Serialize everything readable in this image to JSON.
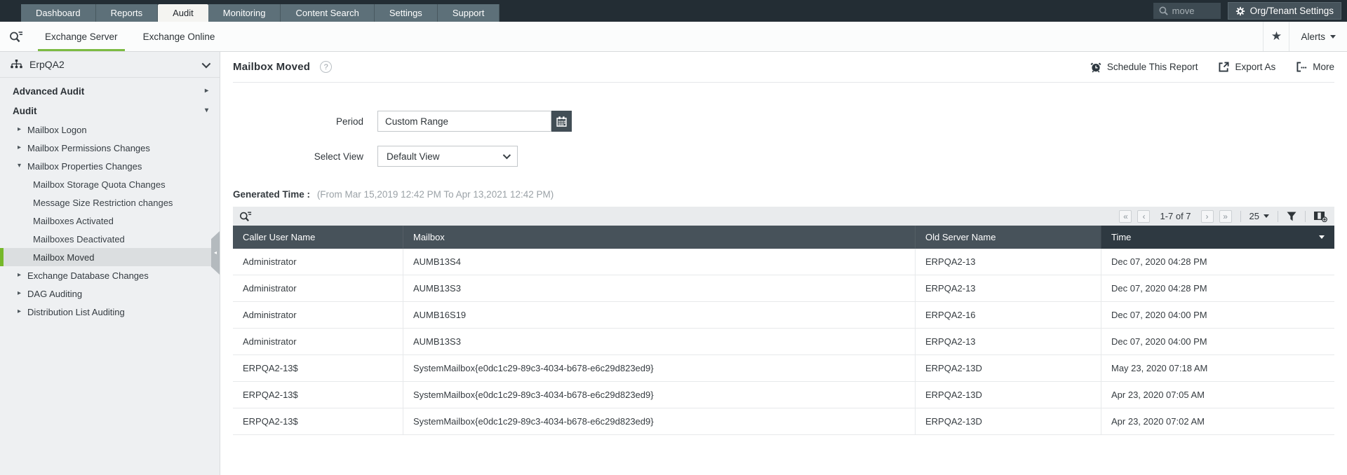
{
  "colors": {
    "accent_green": "#7cbb42",
    "topnav_bg": "#232d34",
    "table_header_bg": "#47525a",
    "table_header_sorted_bg": "#2e3941",
    "sidebar_bg": "#eef0f2"
  },
  "topnav": {
    "tabs": [
      {
        "label": "Dashboard"
      },
      {
        "label": "Reports"
      },
      {
        "label": "Audit"
      },
      {
        "label": "Monitoring"
      },
      {
        "label": "Content Search"
      },
      {
        "label": "Settings"
      },
      {
        "label": "Support"
      }
    ],
    "active_tab": "Audit",
    "search_value": "move",
    "org_settings_label": "Org/Tenant Settings"
  },
  "subnav": {
    "tabs": [
      {
        "label": "Exchange Server"
      },
      {
        "label": "Exchange Online"
      }
    ],
    "active_tab": "Exchange Server",
    "alerts_label": "Alerts"
  },
  "sidebar": {
    "org_name": "ErpQA2",
    "items": [
      {
        "label": "Advanced Audit",
        "type": "section",
        "state": "collapsed"
      },
      {
        "label": "Audit",
        "type": "section",
        "state": "expanded"
      },
      {
        "label": "Mailbox Logon",
        "type": "tree",
        "state": "collapsed"
      },
      {
        "label": "Mailbox Permissions Changes",
        "type": "tree",
        "state": "collapsed"
      },
      {
        "label": "Mailbox Properties Changes",
        "type": "tree",
        "state": "expanded"
      },
      {
        "label": "Mailbox Storage Quota Changes",
        "type": "leaf",
        "selected": false
      },
      {
        "label": "Message Size Restriction changes",
        "type": "leaf",
        "selected": false
      },
      {
        "label": "Mailboxes Activated",
        "type": "leaf",
        "selected": false
      },
      {
        "label": "Mailboxes Deactivated",
        "type": "leaf",
        "selected": false
      },
      {
        "label": "Mailbox Moved",
        "type": "leaf",
        "selected": true
      },
      {
        "label": "Exchange Database Changes",
        "type": "tree",
        "state": "collapsed"
      },
      {
        "label": "DAG Auditing",
        "type": "tree",
        "state": "collapsed"
      },
      {
        "label": "Distribution List Auditing",
        "type": "tree",
        "state": "collapsed"
      }
    ]
  },
  "main": {
    "title": "Mailbox Moved",
    "actions": [
      {
        "label": "Schedule This Report",
        "icon": "alarm-clock-icon"
      },
      {
        "label": "Export As",
        "icon": "export-icon"
      },
      {
        "label": "More",
        "icon": "more-icon"
      }
    ],
    "form": {
      "period_label": "Period",
      "period_value": "Custom Range",
      "select_view_label": "Select View",
      "select_view_value": "Default View"
    },
    "generated_time": {
      "label": "Generated Time :",
      "range": "(From Mar 15,2019 12:42 PM To Apr 13,2021 12:42 PM)"
    },
    "pagination": {
      "first": "«",
      "prev": "‹",
      "range_text": "1-7 of 7",
      "next": "›",
      "last": "»",
      "page_size": "25"
    },
    "table": {
      "columns": [
        "Caller User Name",
        "Mailbox",
        "Old Server Name",
        "Time"
      ],
      "sorted_column": "Time",
      "sort_direction": "desc",
      "rows": [
        [
          "Administrator",
          "AUMB13S4",
          "ERPQA2-13",
          "Dec 07, 2020 04:28 PM"
        ],
        [
          "Administrator",
          "AUMB13S3",
          "ERPQA2-13",
          "Dec 07, 2020 04:28 PM"
        ],
        [
          "Administrator",
          "AUMB16S19",
          "ERPQA2-16",
          "Dec 07, 2020 04:00 PM"
        ],
        [
          "Administrator",
          "AUMB13S3",
          "ERPQA2-13",
          "Dec 07, 2020 04:00 PM"
        ],
        [
          "ERPQA2-13$",
          "SystemMailbox{e0dc1c29-89c3-4034-b678-e6c29d823ed9}",
          "ERPQA2-13D",
          "May 23, 2020 07:18 AM"
        ],
        [
          "ERPQA2-13$",
          "SystemMailbox{e0dc1c29-89c3-4034-b678-e6c29d823ed9}",
          "ERPQA2-13D",
          "Apr 23, 2020 07:05 AM"
        ],
        [
          "ERPQA2-13$",
          "SystemMailbox{e0dc1c29-89c3-4034-b678-e6c29d823ed9}",
          "ERPQA2-13D",
          "Apr 23, 2020 07:02 AM"
        ]
      ]
    }
  }
}
